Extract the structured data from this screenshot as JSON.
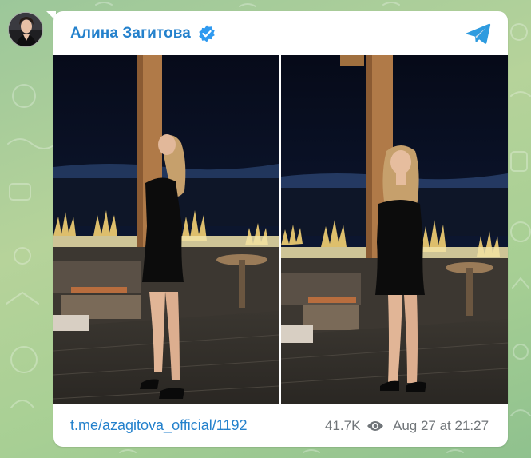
{
  "channel": {
    "name": "Алина Загитова",
    "verified": true,
    "avatar_icon": "channel-avatar"
  },
  "app": {
    "logo_icon": "telegram-logo-icon",
    "accent_color": "#2481cc",
    "secondary_text_color": "#707579"
  },
  "media": {
    "photos": [
      {
        "name": "photo-left"
      },
      {
        "name": "photo-right"
      }
    ]
  },
  "footer": {
    "post_link": "t.me/azagitova_official/1192",
    "views": "41.7K",
    "views_icon": "eye-icon",
    "date": "Aug 27 at 21:27"
  }
}
